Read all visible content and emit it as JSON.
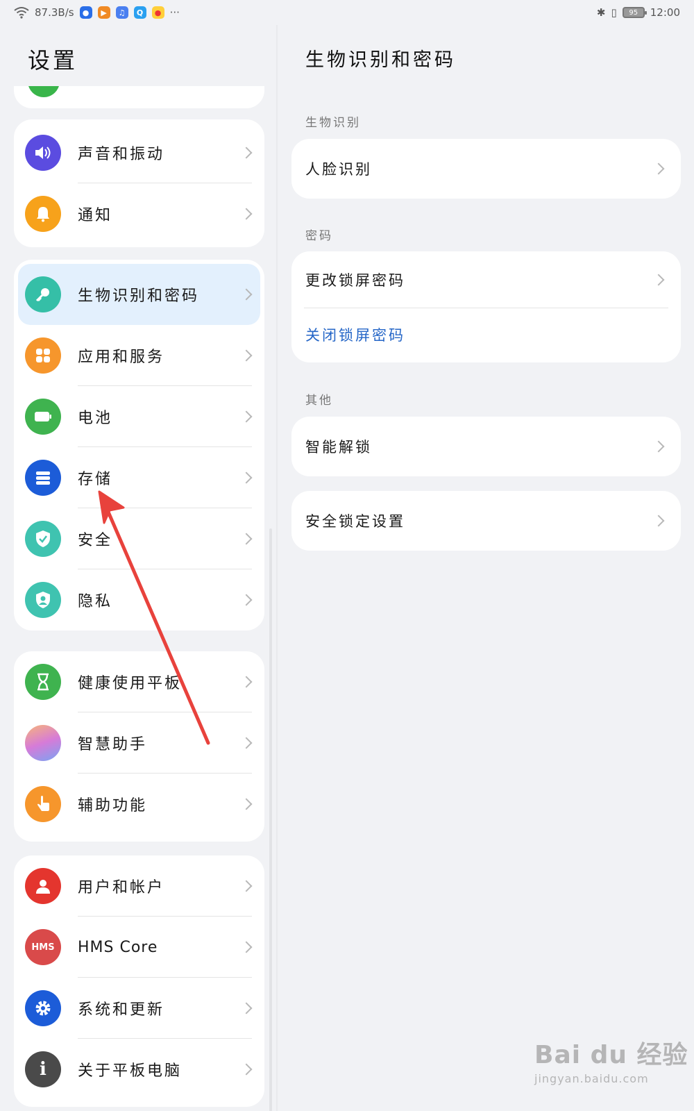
{
  "status_bar": {
    "speed": "87.3B/s",
    "more": "···",
    "battery": "95",
    "time": "12:00"
  },
  "left": {
    "title": "设置",
    "groups": [
      {
        "items": [
          {
            "label": "声音和振动",
            "icon": "speaker-icon",
            "color": "#5b4ce0"
          },
          {
            "label": "通知",
            "icon": "bell-icon",
            "color": "#f7a21b"
          }
        ]
      },
      {
        "items": [
          {
            "label": "生物识别和密码",
            "icon": "key-icon",
            "color": "#35bfa7",
            "active": true
          },
          {
            "label": "应用和服务",
            "icon": "apps-grid-icon",
            "color": "#f6962c"
          },
          {
            "label": "电池",
            "icon": "battery-icon",
            "color": "#3fb34f"
          },
          {
            "label": "存储",
            "icon": "storage-icon",
            "color": "#1c5cd8"
          },
          {
            "label": "安全",
            "icon": "shield-check-icon",
            "color": "#3fc3b0"
          },
          {
            "label": "隐私",
            "icon": "privacy-shield-icon",
            "color": "#3fc3b0"
          }
        ]
      },
      {
        "items": [
          {
            "label": "健康使用平板",
            "icon": "hourglass-icon",
            "color": "#3fb34f"
          },
          {
            "label": "智慧助手",
            "icon": "assistant-icon",
            "color": "#d88bd6"
          },
          {
            "label": "辅助功能",
            "icon": "hand-icon",
            "color": "#f6962c"
          }
        ]
      },
      {
        "items": [
          {
            "label": "用户和帐户",
            "icon": "user-icon",
            "color": "#e4352e"
          },
          {
            "label": "HMS Core",
            "icon": "hms-icon",
            "color": "#d94a4a",
            "icon_text": "HMS"
          },
          {
            "label": "系统和更新",
            "icon": "gear-icon",
            "color": "#1c5cd8"
          },
          {
            "label": "关于平板电脑",
            "icon": "info-icon",
            "color": "#4a4a4a"
          }
        ]
      }
    ]
  },
  "right": {
    "title": "生物识别和密码",
    "sections": [
      {
        "label": "生物识别",
        "items": [
          {
            "label": "人脸识别",
            "chevron": true
          }
        ]
      },
      {
        "label": "密码",
        "items": [
          {
            "label": "更改锁屏密码",
            "chevron": true
          },
          {
            "label": "关闭锁屏密码",
            "link": true
          }
        ]
      },
      {
        "label": "其他",
        "items": [
          {
            "label": "智能解锁",
            "chevron": true
          }
        ]
      },
      {
        "label": "",
        "items": [
          {
            "label": "安全锁定设置",
            "chevron": true
          }
        ]
      }
    ]
  },
  "watermark": {
    "main": "Bai du 经验",
    "sub": "jingyan.baidu.com"
  }
}
